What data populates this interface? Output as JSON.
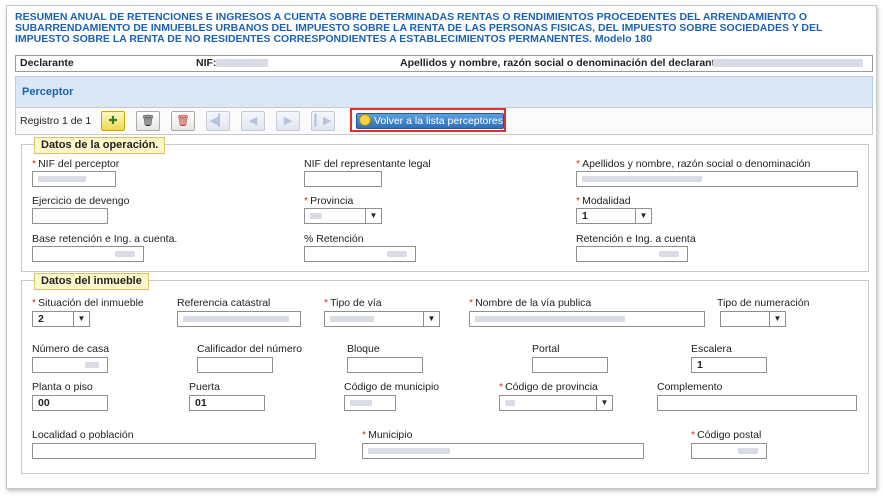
{
  "title": "RESUMEN ANUAL DE RETENCIONES E INGRESOS A CUENTA SOBRE DETERMINADAS RENTAS O RENDIMIENTOS PROCEDENTES DEL ARRENDAMIENTO O SUBARRENDAMIENTO DE INMUEBLES URBANOS DEL IMPUESTO SOBRE LA RENTA DE LAS PERSONAS FISICAS, DEL IMPUESTO SOBRE SOCIEDADES Y DEL IMPUESTO SOBRE LA RENTA DE NO RESIDENTES CORRESPONDIENTES A ESTABLECIMIENTOS PERMANENTES. Modelo 180",
  "declarante_bar": {
    "declarante_label": "Declarante",
    "nif_label": "NIF:",
    "apellidos_label": "Apellidos y nombre, razón social o denominación del declarante.:"
  },
  "perceptor_header": "Perceptor",
  "toolbar": {
    "registro": "Registro 1 de 1",
    "volver_label": "Volver a la lista perceptores"
  },
  "operacion": {
    "legend": "Datos de la operación.",
    "nif_perceptor": {
      "label": "NIF del perceptor",
      "required": "*"
    },
    "nif_representante": {
      "label": "NIF del representante legal",
      "value": ""
    },
    "apellidos": {
      "label": "Apellidos y nombre, razón social o denominación",
      "required": "*"
    },
    "ejercicio": {
      "label": "Ejercicio de devengo",
      "value": ""
    },
    "provincia": {
      "label": "Provincia",
      "required": "*"
    },
    "modalidad": {
      "label": "Modalidad",
      "required": "*",
      "value": "1"
    },
    "base": {
      "label": "Base retención e Ing. a cuenta."
    },
    "porcentaje": {
      "label": "% Retención"
    },
    "retencion": {
      "label": "Retención e Ing. a cuenta"
    }
  },
  "inmueble": {
    "legend": "Datos del inmueble",
    "situacion": {
      "label": "Situación del inmueble",
      "required": "*",
      "value": "2"
    },
    "referencia": {
      "label": "Referencia catastral"
    },
    "tipo_via": {
      "label": "Tipo de vía",
      "required": "*"
    },
    "nombre_via": {
      "label": "Nombre de la vía publica",
      "required": "*"
    },
    "tipo_numeracion": {
      "label": "Tipo de numeración",
      "value": ""
    },
    "numero_casa": {
      "label": "Número de casa"
    },
    "calificador": {
      "label": "Calificador del número",
      "value": ""
    },
    "bloque": {
      "label": "Bloque",
      "value": ""
    },
    "portal": {
      "label": "Portal",
      "value": ""
    },
    "escalera": {
      "label": "Escalera",
      "value": "1"
    },
    "planta": {
      "label": "Planta o piso",
      "value": "00"
    },
    "puerta": {
      "label": "Puerta",
      "value": "01"
    },
    "cod_municipio": {
      "label": "Código de municipio"
    },
    "cod_provincia": {
      "label": "Código de provincia",
      "required": "*"
    },
    "complemento": {
      "label": "Complemento",
      "value": ""
    },
    "localidad": {
      "label": "Localidad o población",
      "value": ""
    },
    "municipio": {
      "label": "Municipio",
      "required": "*"
    },
    "codigo_postal": {
      "label": "Código postal",
      "required": "*"
    }
  },
  "icons": {
    "add": "add-record-icon",
    "delete": "trash-icon",
    "delete_all": "trash-red-icon",
    "first": "first-icon",
    "prev": "prev-icon",
    "next": "next-icon",
    "last": "last-icon",
    "volver": "return-list-icon"
  },
  "colors": {
    "title_blue": "#1b62b6",
    "required_red": "#d0312d",
    "highlight_red": "#e0302a",
    "legend_bg": "#fdf6c8"
  }
}
